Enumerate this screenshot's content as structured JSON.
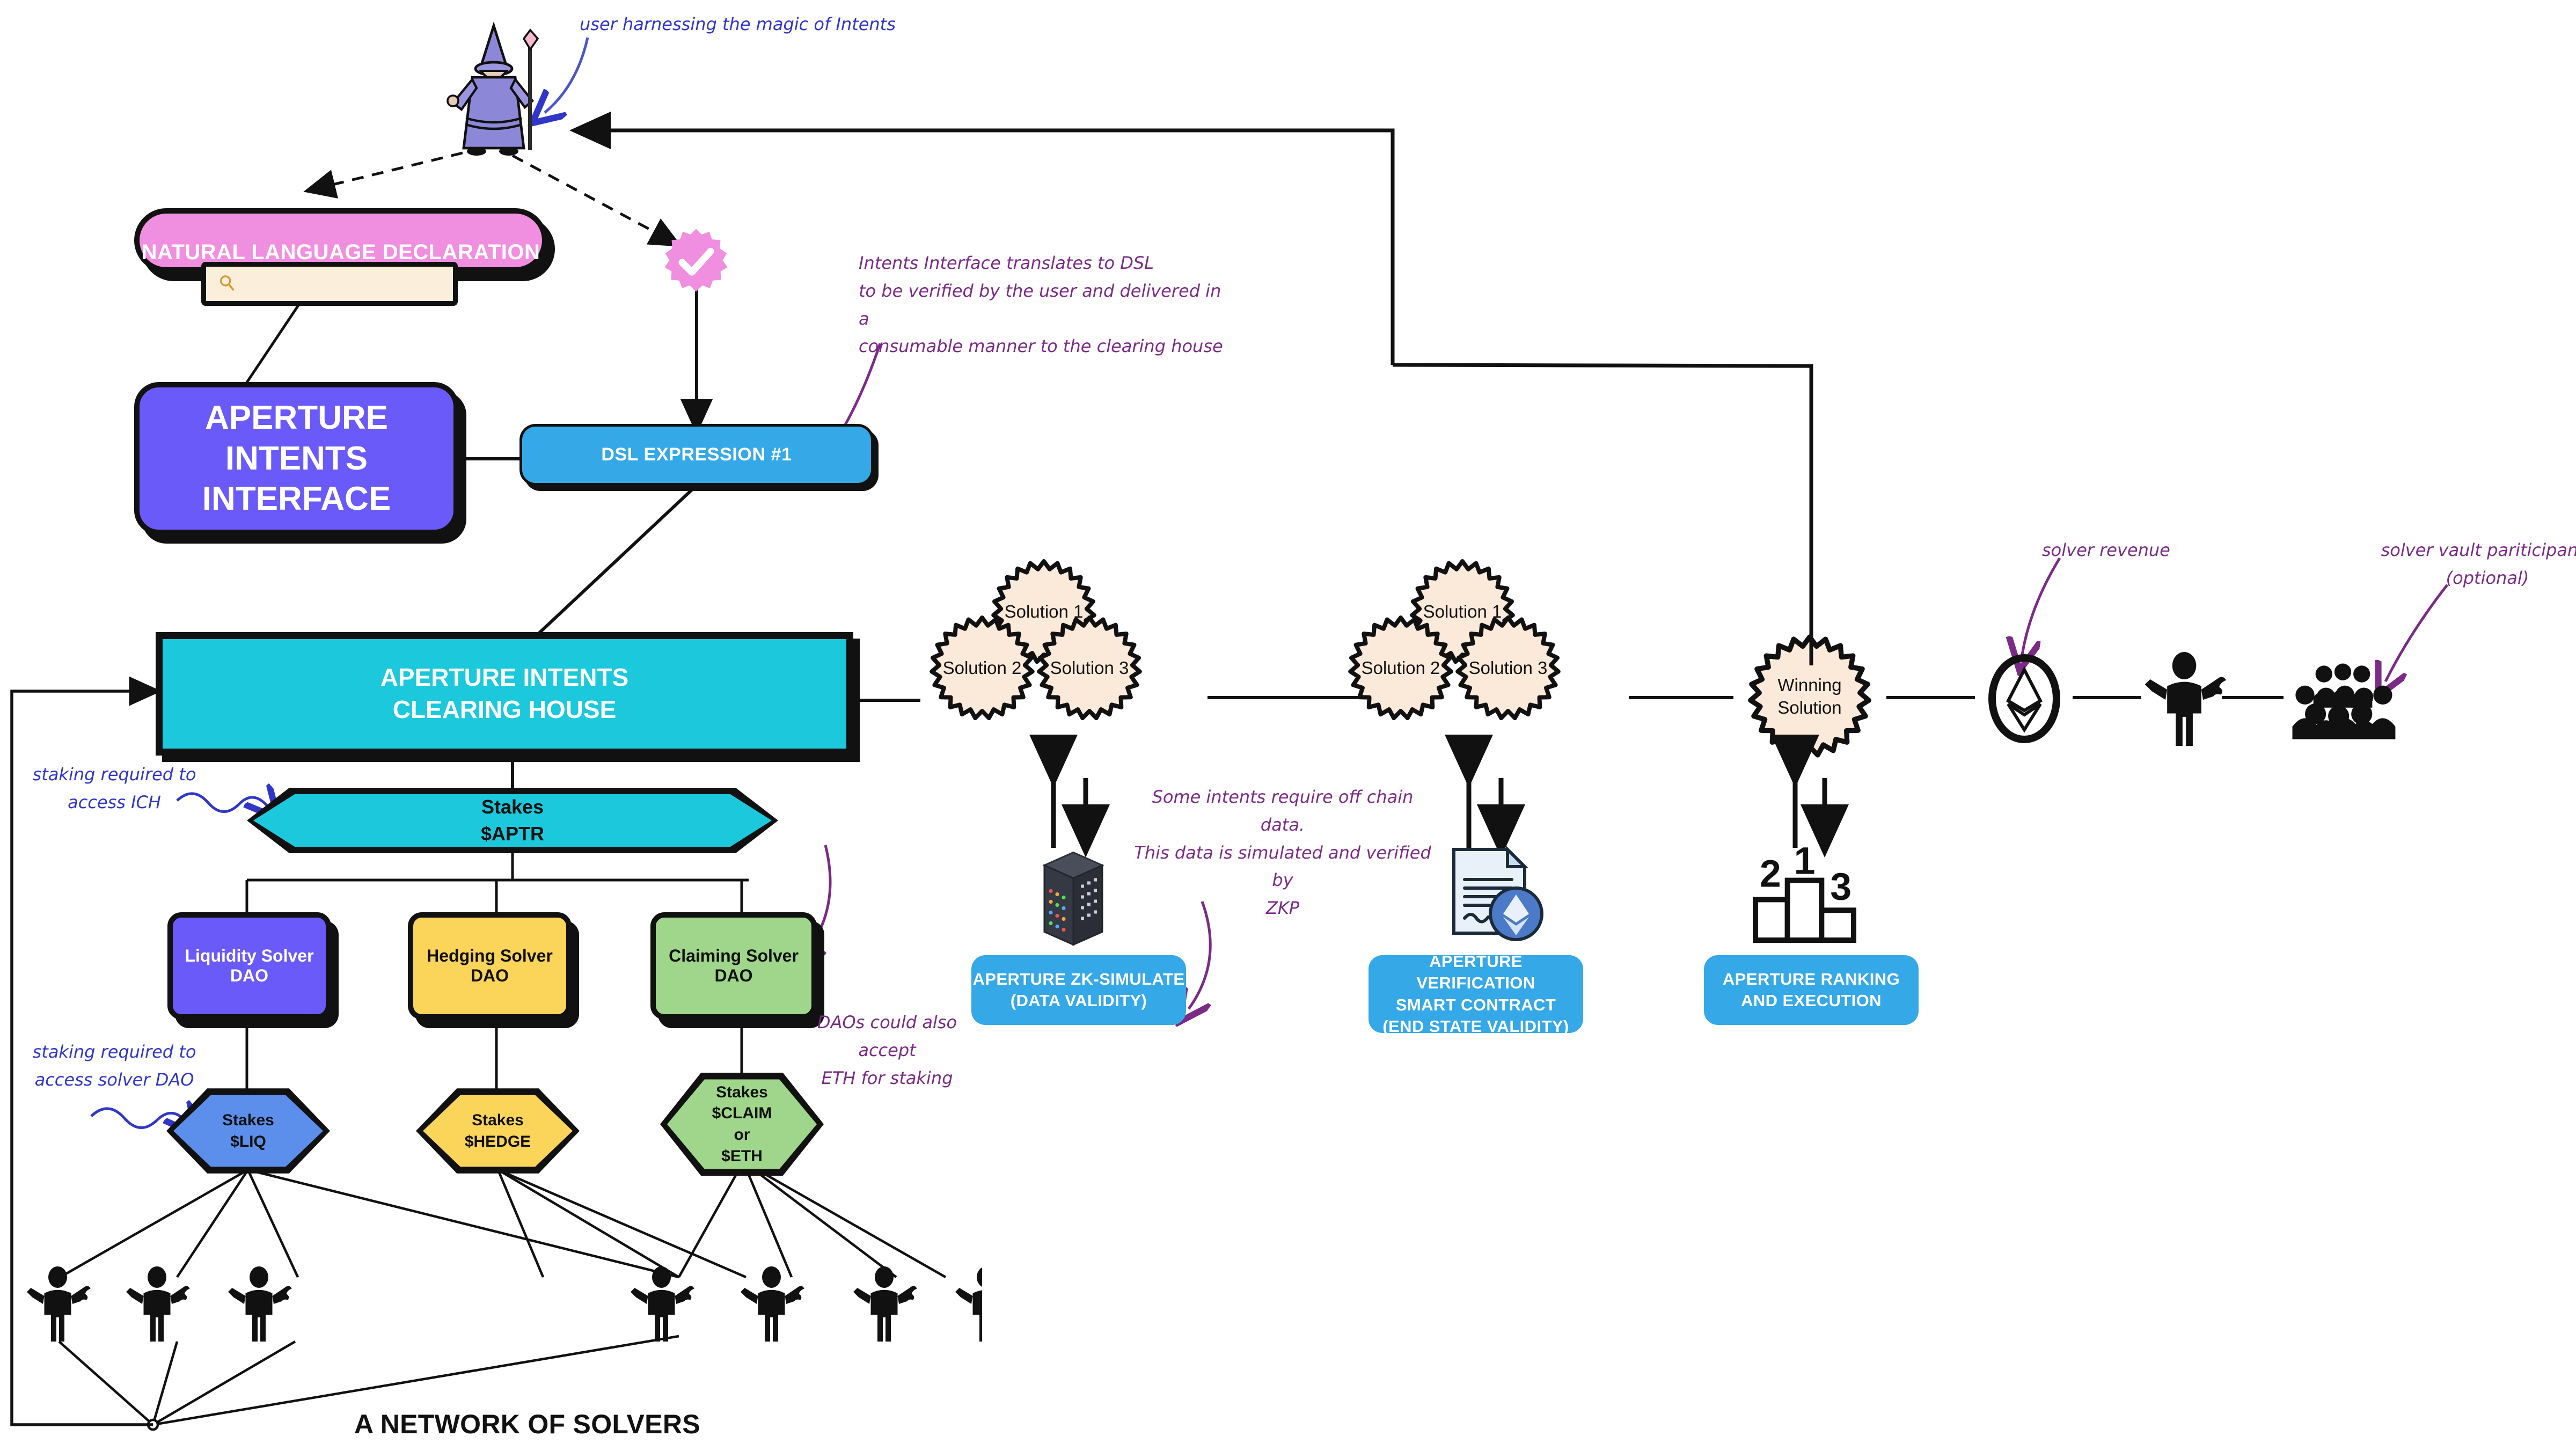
{
  "diagram": {
    "bottom_title": "A NETWORK OF SOLVERS"
  },
  "nodes": {
    "natural_language_declaration": {
      "label": "NATURAL LANGUAGE DECLARATION",
      "color": "#F08EE0",
      "field_value": "",
      "field_icon": "magnifier-icon"
    },
    "aperture_intents_interface": {
      "label_line1": "APERTURE INTENTS",
      "label_line2": "INTERFACE",
      "color": "#6A5AF9"
    },
    "dsl_expression": {
      "label": "DSL EXPRESSION  #1",
      "color": "#35A8E8"
    },
    "clearing_house": {
      "label_line1": "APERTURE INTENTS",
      "label_line2": "CLEARING HOUSE",
      "color": "#1BC8DC"
    },
    "stakes_aptr": {
      "line1": "Stakes",
      "line2": "$APTR",
      "color": "#1BC8DC"
    },
    "verified_badge": {
      "icon": "check-badge-icon",
      "color": "#F08EE0"
    }
  },
  "dao_boxes": [
    {
      "label": "Liquidity Solver DAO",
      "color": "#6A5AF9",
      "text_color": "#ffffff"
    },
    {
      "label": "Hedging Solver DAO",
      "color": "#FBD45A",
      "text_color": "#111111"
    },
    {
      "label": "Claiming Solver DAO",
      "color": "#9FD68B",
      "text_color": "#111111"
    }
  ],
  "stake_hexes": [
    {
      "line1": "Stakes",
      "line2": "$LIQ",
      "line3": "",
      "line4": "",
      "color": "#5C8EEB"
    },
    {
      "line1": "Stakes",
      "line2": "$HEDGE",
      "line3": "",
      "line4": "",
      "color": "#FBD45A"
    },
    {
      "line1": "Stakes",
      "line2": "$CLAIM",
      "line3": "or",
      "line4": "$ETH",
      "color": "#9FD68B"
    }
  ],
  "solution_groups": [
    {
      "clouds": [
        "Solution 1",
        "Solution 2",
        "Solution 3"
      ]
    },
    {
      "clouds": [
        "Solution 1",
        "Solution 2",
        "Solution 3"
      ]
    }
  ],
  "winning_solution": {
    "line1": "Winning",
    "line2": "Solution"
  },
  "service_boxes": [
    {
      "line1": "APERTURE ZK-SIMULATE",
      "line2": "(DATA VALIDITY)",
      "line3": "",
      "icon": "server-rack-icon"
    },
    {
      "line1": "APERTURE VERIFICATION",
      "line2": "SMART CONTRACT",
      "line3": "(END STATE VALIDITY)",
      "icon": "contract-ethereum-icon"
    },
    {
      "line1": "APERTURE RANKING",
      "line2": "AND EXECUTION",
      "line3": "",
      "icon": "podium-icon"
    }
  ],
  "podium_ranks": [
    "2",
    "1",
    "3"
  ],
  "annotations": {
    "user_magic": "user harnessing the magic of Intents",
    "intents_translate": "Intents Interface translates to DSL\nto be verified by the user and delivered in a\nconsumable manner to the clearing house",
    "staking_ich": "staking required to\naccess ICH",
    "staking_solver_dao": "staking required to\naccess solver DAO",
    "daos_eth": "DAOs could also accept\nETH for staking",
    "offchain_zkp": "Some intents require off chain data.\nThis data is simulated and verified by\nZKP",
    "solver_revenue": "solver revenue",
    "solver_vault": "solver vault pariticipants\n(optional)"
  },
  "icons": {
    "wizard": "wizard-icon",
    "solver": "solver-person-wrench-icon",
    "crowd": "crowd-icon",
    "ethereum": "ethereum-icon",
    "laptops": "laptop-grid-icon"
  },
  "colors": {
    "pink": "#F08EE0",
    "purple": "#6A5AF9",
    "blue": "#35A8E8",
    "teal": "#1BC8DC",
    "yellow": "#FBD45A",
    "green": "#9FD68B",
    "cloud": "#FBEADA",
    "annotation_purple": "#7A2B86",
    "annotation_blue": "#2F36C8",
    "outline": "#111111"
  }
}
